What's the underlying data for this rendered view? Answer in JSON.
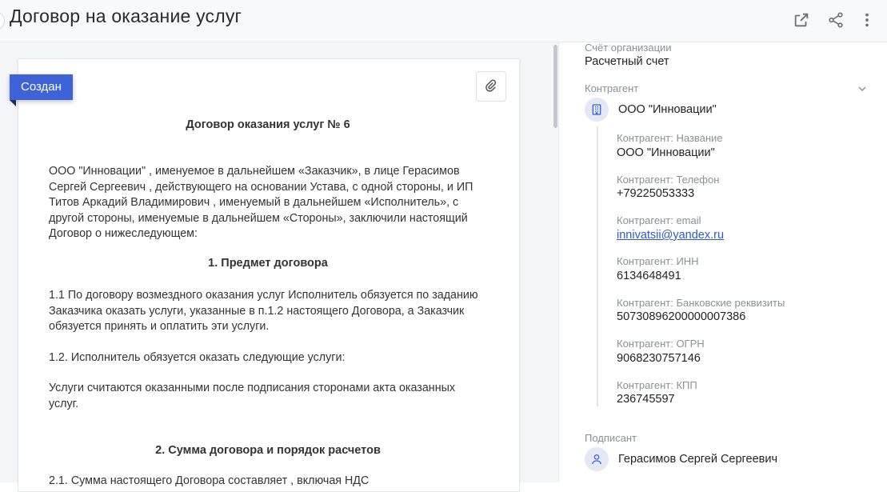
{
  "header": {
    "title": "Договор на оказание услуг",
    "icons": [
      "external-link-icon",
      "share-icon",
      "more-vertical-icon"
    ]
  },
  "document": {
    "status": "Создан",
    "title": "Договор оказания услуг № 6",
    "intro": "ООО \"Инновации\" , именуемое в дальнейшем «Заказчик», в лице Герасимов Сергей Сергеевич , действующего на основании Устава, с одной стороны, и ИП Титов Аркадий Владимирович , именуемый в дальнейшем «Исполнитель», с другой стороны, именуемые в дальнейшем «Стороны», заключили настоящий Договор о нижеследующем:",
    "section1_title": "1. Предмет договора",
    "p1_1": "1.1 По договору возмездного оказания услуг Исполнитель обязуется по заданию Заказчика оказать услуги, указанные в п.1.2 настоящего Договора, а Заказчик обязуется принять и оплатить эти услуги.",
    "p1_2": "1.2. Исполнитель обязуется оказать следующие услуги:",
    "p_services": "Услуги считаются оказанными после подписания сторонами акта оказанных услуг.",
    "section2_title": "2. Сумма договора и порядок расчетов",
    "p2_1": "2.1. Сумма настоящего Договора составляет , включая НДС"
  },
  "details": {
    "account_label": "Счёт организации",
    "account_value": "Расчетный счет",
    "counterparty_label": "Контрагент",
    "counterparty_name": "ООО \"Инновации\"",
    "fields": [
      {
        "label": "Контрагент: Название",
        "value": "ООО \"Инновации\""
      },
      {
        "label": "Контрагент: Телефон",
        "value": "+79225053333"
      },
      {
        "label": "Контрагент: email",
        "value": "innivatsii@yandex.ru"
      },
      {
        "label": "Контрагент: ИНН",
        "value": "6134648491"
      },
      {
        "label": "Контрагент: Банковские реквизиты",
        "value": "50730896200000007386"
      },
      {
        "label": "Контрагент: ОГРН",
        "value": "9068230757146"
      },
      {
        "label": "Контрагент: КПП",
        "value": "236745597"
      }
    ],
    "signer_label": "Подписант",
    "signer_name": "Герасимов Сергей Сергеевич"
  },
  "colors": {
    "accent": "#3e63d8",
    "link": "#3057c9",
    "label": "#8a8f98"
  }
}
